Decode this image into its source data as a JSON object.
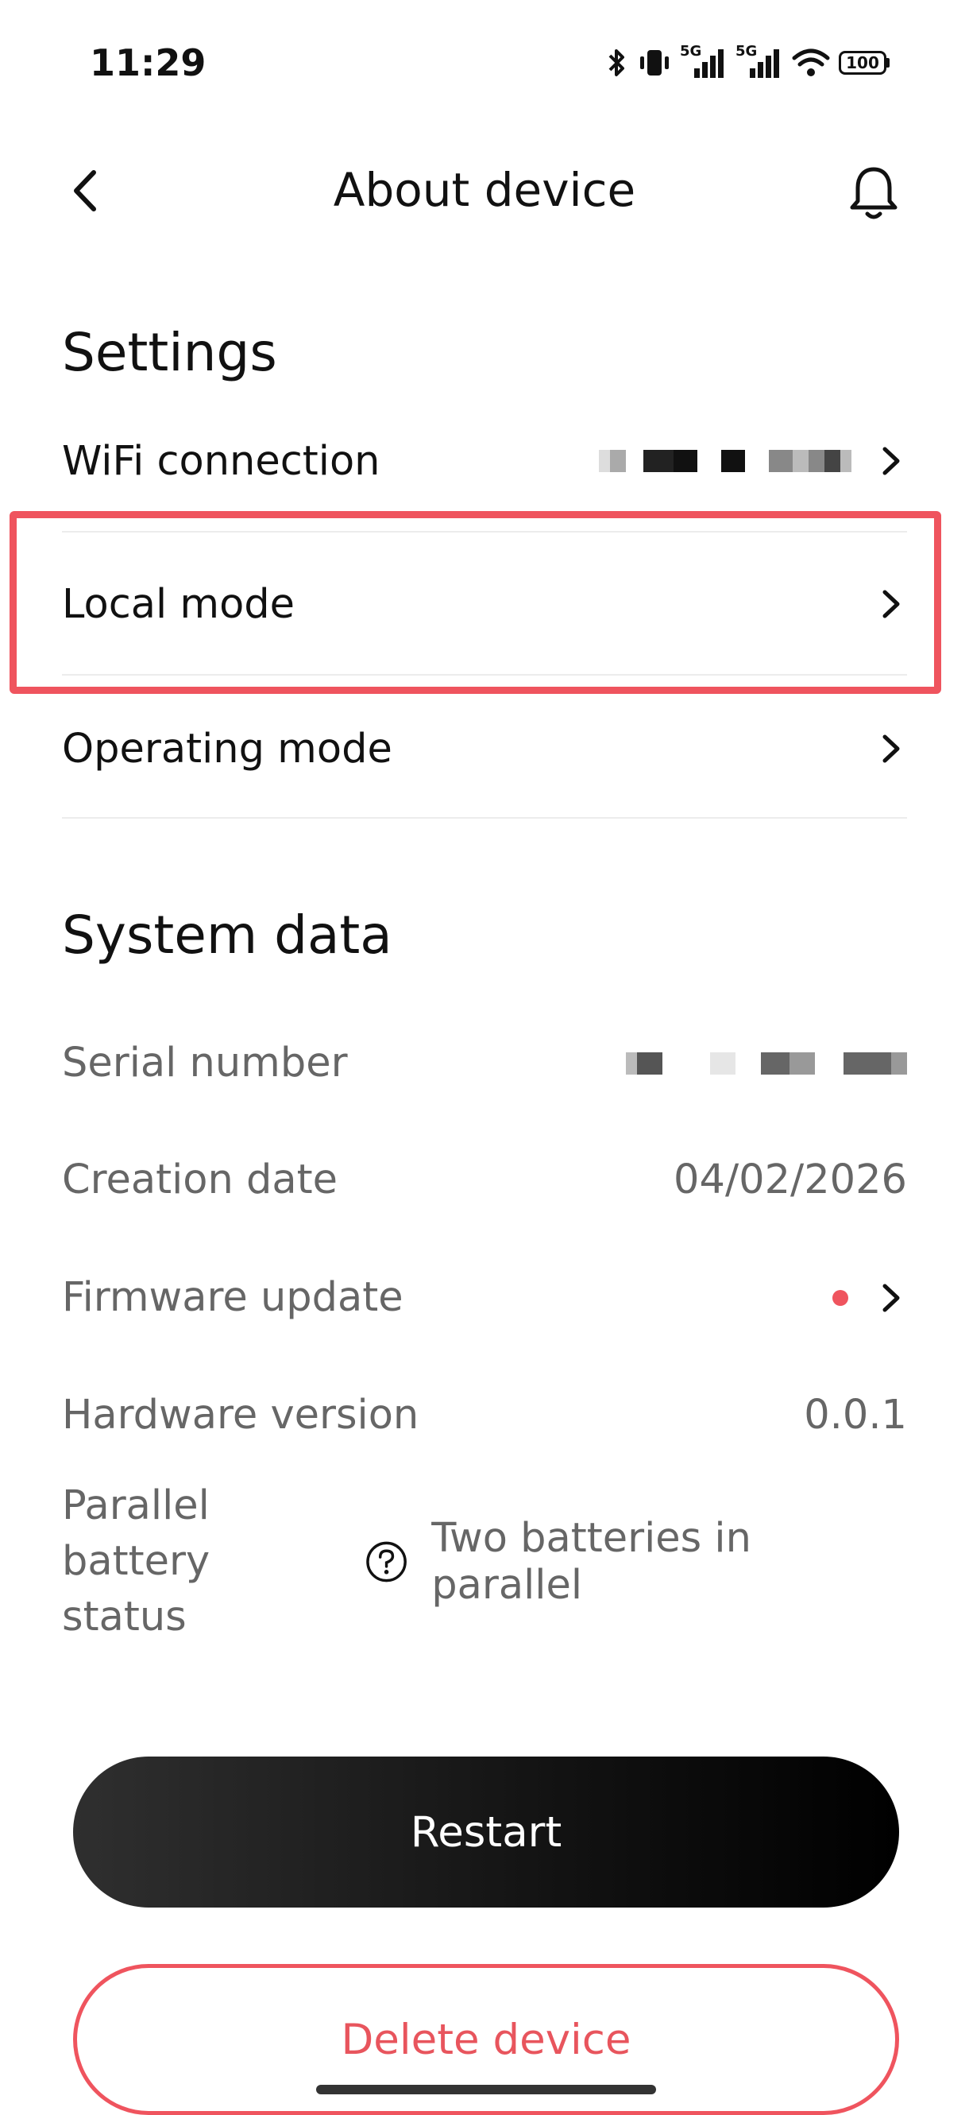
{
  "status_bar": {
    "time": "11:29",
    "network_1": "5G",
    "network_2": "5G",
    "battery": "100"
  },
  "header": {
    "title": "About device"
  },
  "settings": {
    "section_title": "Settings",
    "wifi_label": "WiFi connection",
    "local_mode_label": "Local mode",
    "operating_mode_label": "Operating mode"
  },
  "system": {
    "section_title": "System data",
    "serial_label": "Serial number",
    "creation_label": "Creation date",
    "creation_value": "04/02/2026",
    "firmware_label": "Firmware update",
    "hardware_label": "Hardware version",
    "hardware_value": "0.0.1",
    "parallel_label_line1": "Parallel battery",
    "parallel_label_line2": "status",
    "parallel_value": "Two batteries in parallel"
  },
  "actions": {
    "restart_label": "Restart",
    "delete_label": "Delete device"
  },
  "colors": {
    "accent_red": "#ef545e",
    "text_primary": "#111111",
    "text_secondary": "#666666"
  }
}
